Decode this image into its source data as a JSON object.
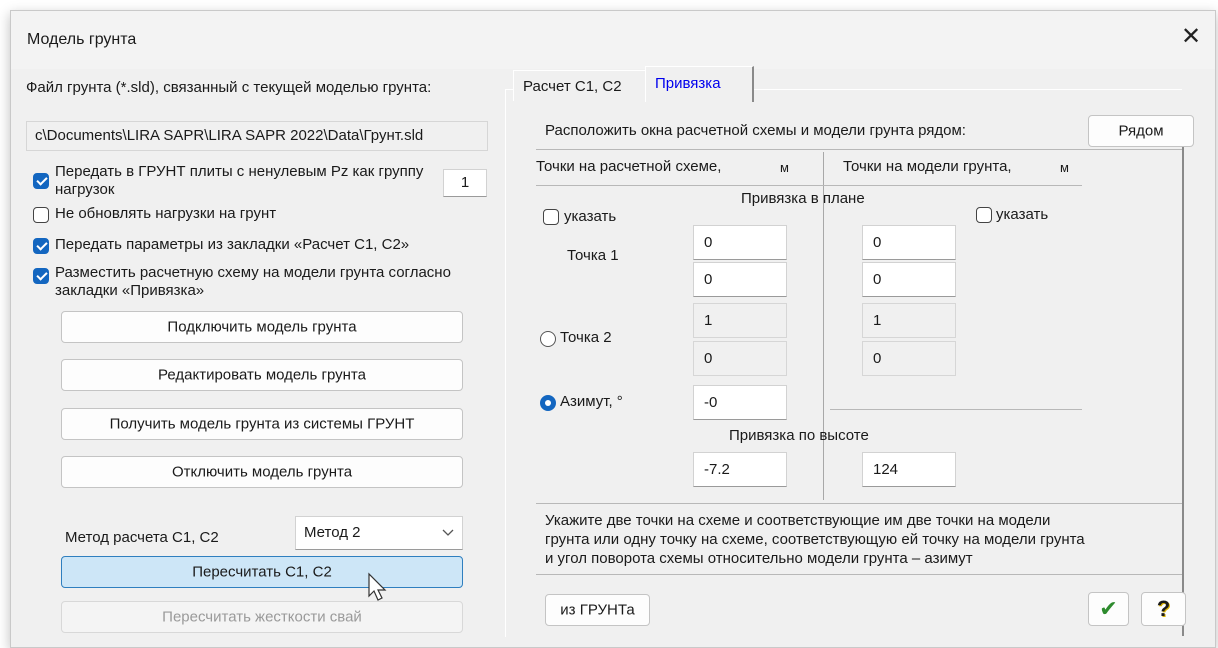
{
  "window": {
    "title": "Модель грунта",
    "close": "✕"
  },
  "left": {
    "file_label": "Файл грунта (*.sld), связанный с текущей моделью грунта:",
    "file_path": "c\\Documents\\LIRA SAPR\\LIRA SAPR 2022\\Data\\Грунт.sld",
    "cb1_label": "Передать в ГРУНТ плиты с ненулевым Pz как группу нагрузок",
    "cb1_value": "1",
    "cb2_label": "Не обновлять нагрузки на грунт",
    "cb3_label": "Передать параметры из закладки «Расчет С1, С2»",
    "cb4_label": "Разместить расчетную схему на модели грунта согласно закладки «Привязка»",
    "btn_connect": "Подключить модель грунта",
    "btn_edit": "Редактировать модель грунта",
    "btn_get": "Получить модель грунта из системы ГРУНТ",
    "btn_disconnect": "Отключить модель грунта",
    "method_label": "Метод расчета С1, С2",
    "method_value": "Метод 2",
    "btn_recalc": "Пересчитать С1, С2",
    "btn_recalc_piles": "Пересчитать жесткости свай"
  },
  "tabs": {
    "tab1": "Расчет С1, С2",
    "tab2": "Привязка"
  },
  "right": {
    "place_label": "Расположить окна расчетной схемы и модели грунта рядом:",
    "btn_near": "Рядом",
    "col_scheme": "Точки на расчетной схеме,",
    "col_scheme_unit": "м",
    "col_model": "Точки на модели грунта,",
    "col_model_unit": "м",
    "plan_header": "Привязка в плане",
    "indicate_left": "указать",
    "indicate_right": "указать",
    "point1_label": "Точка 1",
    "point2_label": "Точка 2",
    "azimuth_label": "Азимут, °",
    "p1_scheme_x": "0",
    "p1_scheme_y": "0",
    "p1_model_x": "0",
    "p1_model_y": "0",
    "p2_scheme_x": "1",
    "p2_scheme_y": "0",
    "p2_model_x": "1",
    "p2_model_y": "0",
    "azimuth_value": "-0",
    "height_header": "Привязка по высоте",
    "height_scheme": "-7.2",
    "height_model": "124",
    "hint_line1": "Укажите две точки на схеме и соответствующие им две точки на модели",
    "hint_line2": "грунта или одну точку на схеме, соответствующую ей точку на модели грунта",
    "hint_line3": "и угол поворота схемы относительно модели грунта – азимут",
    "btn_from_ground": "из ГРУНТа",
    "ok_icon_glyph": "✔",
    "help_icon_glyph": "?"
  },
  "colors": {
    "accent": "#1366c0",
    "tab_active_text": "#0000ee",
    "ok_green": "#2e8b2e",
    "help_yellow": "#d9b100"
  }
}
